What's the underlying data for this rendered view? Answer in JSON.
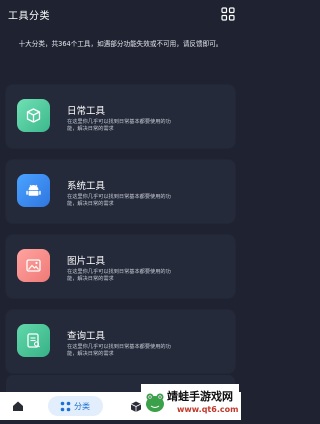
{
  "header": {
    "title": "工具分类",
    "icon": "grid-icon"
  },
  "subtitle": "十大分类，共364个工具，如遇部分功能失效或不可用，请反馈即可。",
  "cards": [
    {
      "title": "日常工具",
      "desc": "在这里你几乎可以找到日常基本都要使用的功能，解决日常的需求",
      "icon": "box-icon",
      "color": "#5ed0a6"
    },
    {
      "title": "系统工具",
      "desc": "在这里你几乎可以找到日常基本都要使用的功能，解决日常的需求",
      "icon": "android-icon",
      "color": "#3b8df2"
    },
    {
      "title": "图片工具",
      "desc": "在这里你几乎可以找到日常基本都要使用的功能，解决日常的需求",
      "icon": "image-icon",
      "color": "#f58a86"
    },
    {
      "title": "查询工具",
      "desc": "在这里你几乎可以找到日常基本都要使用的功能，解决日常的需求",
      "icon": "document-icon",
      "color": "#4cc79a"
    }
  ],
  "tabbar": {
    "home_icon": "home-icon",
    "active_label": "分类",
    "active_icon": "category-icon",
    "cube_icon": "cube-icon"
  },
  "watermark": {
    "main": "靖蛙手游戏网",
    "url": "www.qt6.com"
  },
  "colors": {
    "background": "#1f2331",
    "card": "#252a3a",
    "tab_active_bg": "#e2eefb",
    "tab_active_text": "#1b6fd6"
  }
}
